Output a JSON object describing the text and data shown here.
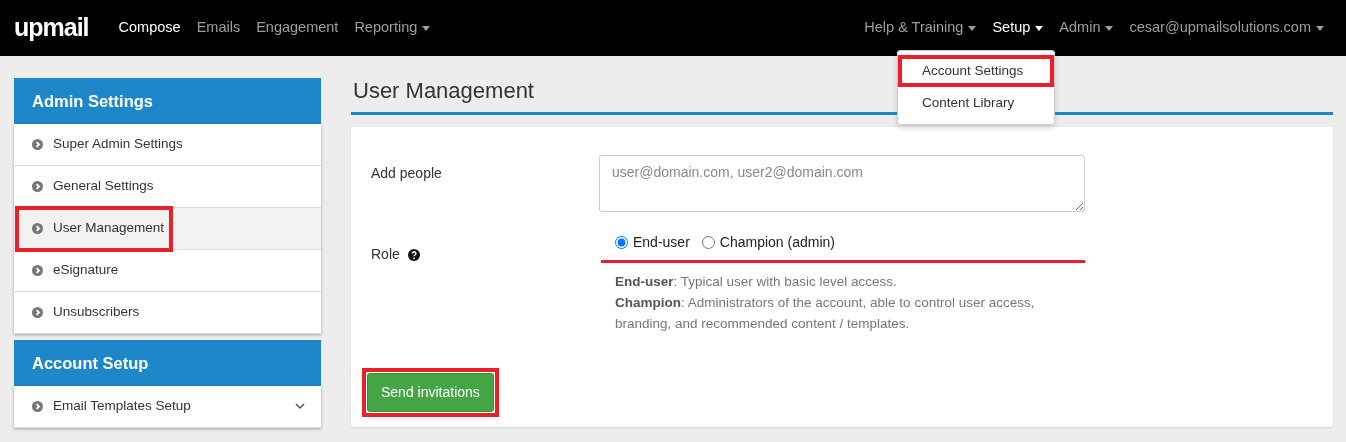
{
  "navbar": {
    "logo": "upmail",
    "left_items": [
      {
        "label": "Compose",
        "selected": true,
        "dropdown": false
      },
      {
        "label": "Emails",
        "selected": false,
        "dropdown": false
      },
      {
        "label": "Engagement",
        "selected": false,
        "dropdown": false
      },
      {
        "label": "Reporting",
        "selected": false,
        "dropdown": true
      }
    ],
    "right_items": [
      {
        "label": "Help & Training",
        "selected": false,
        "dropdown": true
      },
      {
        "label": "Setup",
        "selected": true,
        "dropdown": true
      },
      {
        "label": "Admin",
        "selected": false,
        "dropdown": true
      },
      {
        "label": "cesar@upmailsolutions.com",
        "selected": false,
        "dropdown": true
      }
    ]
  },
  "setup_menu": {
    "items": [
      {
        "label": "Account Settings",
        "highlighted": true
      },
      {
        "label": "Content Library",
        "highlighted": false
      }
    ]
  },
  "sidebar": {
    "sections": [
      {
        "title": "Admin Settings",
        "items": [
          {
            "label": "Super Admin Settings",
            "selected": false,
            "highlighted": false
          },
          {
            "label": "General Settings",
            "selected": false,
            "highlighted": false
          },
          {
            "label": "User Management",
            "selected": true,
            "highlighted": true
          },
          {
            "label": "eSignature",
            "selected": false,
            "highlighted": false
          },
          {
            "label": "Unsubscribers",
            "selected": false,
            "highlighted": false
          }
        ]
      },
      {
        "title": "Account Setup",
        "items": [
          {
            "label": "Email Templates Setup",
            "selected": false,
            "highlighted": false,
            "expandable": true
          }
        ]
      }
    ]
  },
  "page_title": "User Management",
  "form": {
    "add_people": {
      "label": "Add people",
      "placeholder": "user@domain.com, user2@domain.com"
    },
    "role": {
      "label": "Role",
      "underlined": true,
      "options": [
        {
          "label": "End-user",
          "selected": true
        },
        {
          "label": "Champion (admin)",
          "selected": false
        }
      ],
      "help": [
        "**End-user**: Typical user with basic level access.",
        "**Champion**: Administrators of the account, able to control user access, branding, and recommended content / templates."
      ]
    },
    "submit": {
      "label": "Send invitations",
      "highlighted": true
    }
  }
}
